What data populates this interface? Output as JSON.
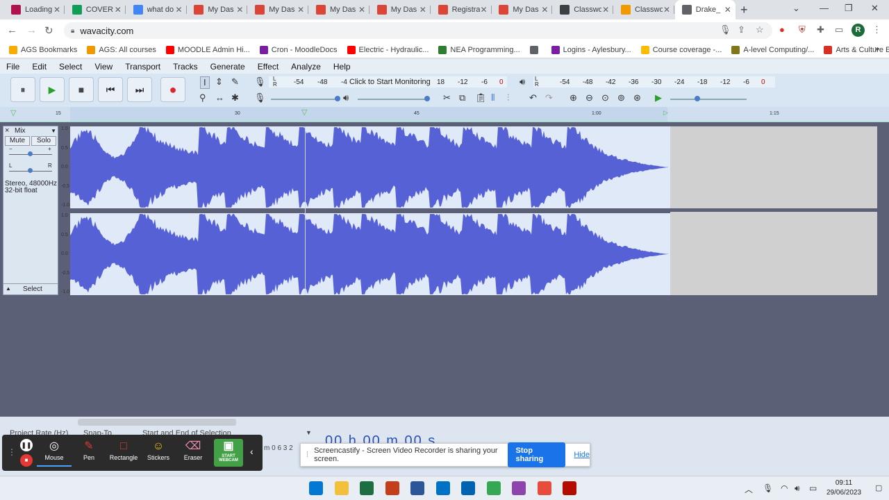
{
  "browser": {
    "tabs": [
      {
        "title": "Loading",
        "color": "#b0124d"
      },
      {
        "title": "COVER",
        "color": "#0f9d58"
      },
      {
        "title": "what do",
        "color": "#4285f4"
      },
      {
        "title": "My Das",
        "color": "#db4437"
      },
      {
        "title": "My Das",
        "color": "#db4437"
      },
      {
        "title": "My Das",
        "color": "#db4437"
      },
      {
        "title": "My Das",
        "color": "#db4437"
      },
      {
        "title": "Registra",
        "color": "#db4437"
      },
      {
        "title": "My Das",
        "color": "#db4437"
      },
      {
        "title": "Classwo",
        "color": "#3c4043"
      },
      {
        "title": "Classwo",
        "color": "#f29900"
      },
      {
        "title": "Drake_",
        "color": "#5f6368"
      }
    ],
    "url": "wavacity.com",
    "avatar_letter": "R",
    "bookmarks": [
      {
        "label": "AGS Bookmarks",
        "color": "#f9ab00"
      },
      {
        "label": "AGS: All courses",
        "color": "#f29900"
      },
      {
        "label": "MOODLE Admin Hi...",
        "color": "#ff0000"
      },
      {
        "label": "Cron - MoodleDocs",
        "color": "#7b1fa2"
      },
      {
        "label": "Electric - Hydraulic...",
        "color": "#ff0000"
      },
      {
        "label": "NEA Programming...",
        "color": "#2e7d32"
      },
      {
        "label": "",
        "color": "#5f6368"
      },
      {
        "label": "Logins - Aylesbury...",
        "color": "#7b1fa2"
      },
      {
        "label": "Course coverage -...",
        "color": "#fbbc04"
      },
      {
        "label": "A-level Computing/...",
        "color": "#827717"
      },
      {
        "label": "Arts & Culture Expe...",
        "color": "#d93025"
      }
    ],
    "bookmarks_more": "»"
  },
  "app": {
    "menus": [
      "File",
      "Edit",
      "Select",
      "View",
      "Transport",
      "Tracks",
      "Generate",
      "Effect",
      "Analyze",
      "Help"
    ],
    "transport": {
      "pause": "⏸",
      "play": "▶",
      "stop": "■",
      "skip_start": "⏮",
      "skip_end": "⏭",
      "record": "●"
    },
    "record_meter": {
      "ticks": [
        "-54",
        "-48",
        "-4"
      ],
      "monitor_text": "Click to Start Monitoring",
      "ticks_right": [
        "18",
        "-12",
        "-6",
        "0"
      ],
      "lr": "L\nR"
    },
    "play_meter": {
      "ticks": [
        "-54",
        "-48",
        "-42",
        "-36",
        "-30",
        "-24",
        "-18",
        "-12",
        "-6",
        "0"
      ]
    },
    "ruler_ticks": [
      "15",
      "30",
      "45",
      "1:00",
      "1:15"
    ],
    "track": {
      "name": "Mix",
      "mute": "Mute",
      "solo": "Solo",
      "gain_minus": "−",
      "gain_plus": "+",
      "pan_l": "L",
      "pan_r": "R",
      "format_line1": "Stereo, 48000Hz",
      "format_line2": "32-bit float",
      "select": "Select",
      "collapse": "▲",
      "close": "×",
      "dropdown": "▼"
    },
    "axis_labels": [
      "1.0",
      "0.5",
      "0.0",
      "-0.5",
      "-1.0"
    ],
    "bottom": {
      "project_rate": "Project Rate (Hz)",
      "snap_to": "Snap-To",
      "selection_mode": "Start and End of Selection",
      "time_display": "00 h 00 m 00 s",
      "rate_value": "m 0 6 3 2"
    }
  },
  "screencastify": {
    "tools": [
      "Mouse",
      "Pen",
      "Rectangle",
      "Stickers",
      "Eraser",
      "START WEBCAM"
    ],
    "share_text": "Screencastify - Screen Video Recorder is sharing your screen.",
    "stop_label": "Stop sharing",
    "hide_label": "Hide"
  },
  "taskbar": {
    "time": "09:11",
    "date": "29/06/2023",
    "apps": [
      {
        "name": "windows-start",
        "color": "#0078d4"
      },
      {
        "name": "file-explorer",
        "color": "#f2c03c"
      },
      {
        "name": "excel",
        "color": "#1d6f42"
      },
      {
        "name": "powerpoint",
        "color": "#c43e1c"
      },
      {
        "name": "word",
        "color": "#2b579a"
      },
      {
        "name": "outlook",
        "color": "#0072c6"
      },
      {
        "name": "mail",
        "color": "#0063b1"
      },
      {
        "name": "chrome",
        "color": "#34a853"
      },
      {
        "name": "app-purple",
        "color": "#8e44ad"
      },
      {
        "name": "snipping-tool",
        "color": "#e74c3c"
      },
      {
        "name": "acrobat",
        "color": "#b30b00"
      }
    ]
  }
}
